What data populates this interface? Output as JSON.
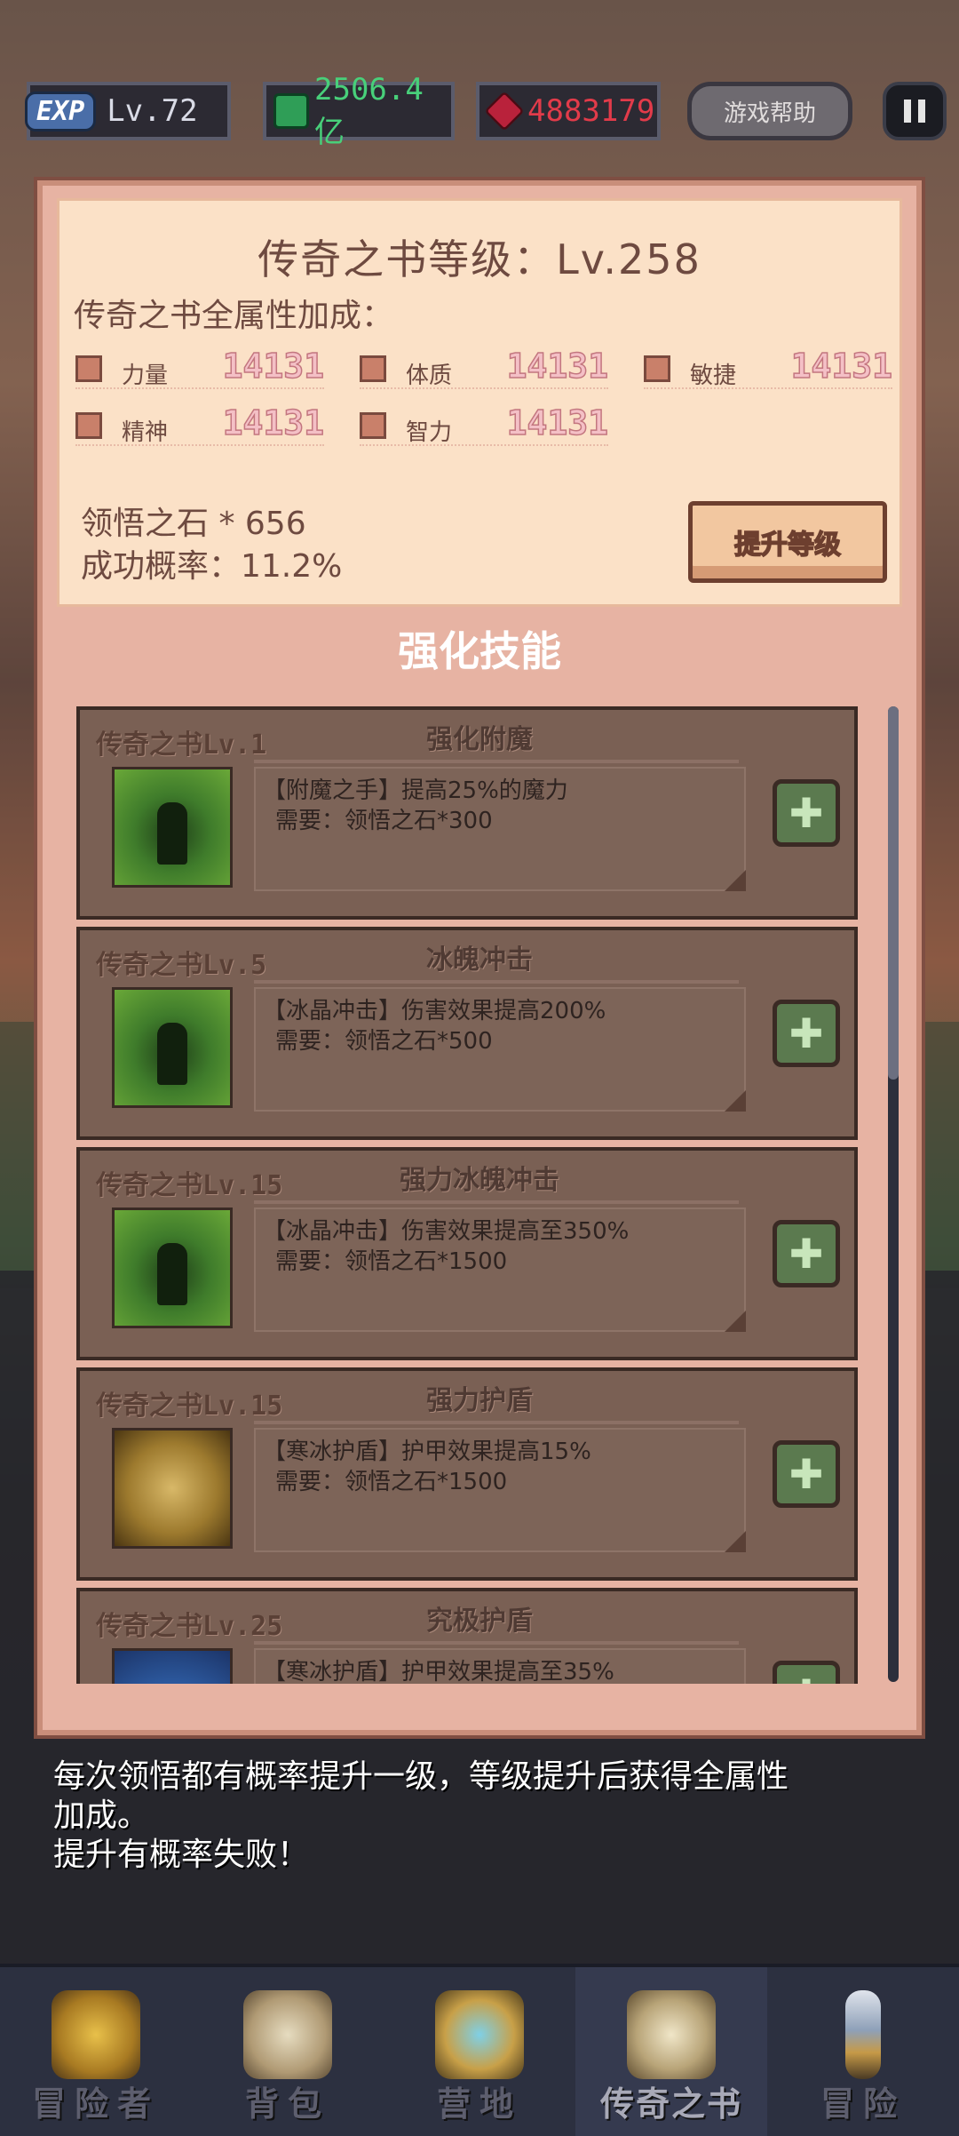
{
  "topbar": {
    "exp_tag": "EXP",
    "level": "Lv.72",
    "gold_icon": "gold-coin-icon",
    "gold": "2506.4亿",
    "gem_icon": "red-gem-icon",
    "gems": "4883179",
    "help_label": "游戏帮助",
    "pause_icon": "pause-icon"
  },
  "panel": {
    "title": "传奇之书等级：Lv.258",
    "bonus_label": "传奇之书全属性加成：",
    "stats": [
      {
        "icon": "strength-icon",
        "label": "力量",
        "value": "14131"
      },
      {
        "icon": "constitution-icon",
        "label": "体质",
        "value": "14131"
      },
      {
        "icon": "agility-icon",
        "label": "敏捷",
        "value": "14131"
      },
      {
        "icon": "spirit-icon",
        "label": "精神",
        "value": "14131"
      },
      {
        "icon": "intelligence-icon",
        "label": "智力",
        "value": "14131"
      }
    ],
    "stone_count": "领悟之石 * 656",
    "success_rate": "成功概率：11.2%",
    "upgrade_label": "提升等级",
    "section_title": "强化技能"
  },
  "skills": [
    {
      "level": "传奇之书Lv.1",
      "name": "强化附魔",
      "desc": "【附魔之手】提高25%的魔力",
      "cost": "需要：领悟之石*300",
      "image": "enchant-hands-icon"
    },
    {
      "level": "传奇之书Lv.5",
      "name": "冰魄冲击",
      "desc": "【冰晶冲击】伤害效果提高200%",
      "cost": "需要：领悟之石*500",
      "image": "ice-strike-icon"
    },
    {
      "level": "传奇之书Lv.15",
      "name": "强力冰魄冲击",
      "desc": "【冰晶冲击】伤害效果提高至350%",
      "cost": "需要：领悟之石*1500",
      "image": "ice-serpent-icon"
    },
    {
      "level": "传奇之书Lv.15",
      "name": "强力护盾",
      "desc": "【寒冰护盾】护甲效果提高15%",
      "cost": "需要：领悟之石*1500",
      "image": "shield-icon"
    },
    {
      "level": "传奇之书Lv.25",
      "name": "究极护盾",
      "desc": "【寒冰护盾】护甲效果提高至35%",
      "cost": "",
      "image": "ultimate-shield-icon"
    }
  ],
  "hint": {
    "line1": "每次领悟都有概率提升一级，等级提升后获得全属性",
    "line2": "加成。",
    "line3": "提升有概率失败！"
  },
  "nav": [
    {
      "label": "冒险者",
      "icon": "adventurer-crown-icon"
    },
    {
      "label": "背包",
      "icon": "backpack-icon"
    },
    {
      "label": "营地",
      "icon": "camp-banner-icon"
    },
    {
      "label": "传奇之书",
      "icon": "legend-book-icon"
    },
    {
      "label": "冒险",
      "icon": "sword-icon"
    }
  ]
}
